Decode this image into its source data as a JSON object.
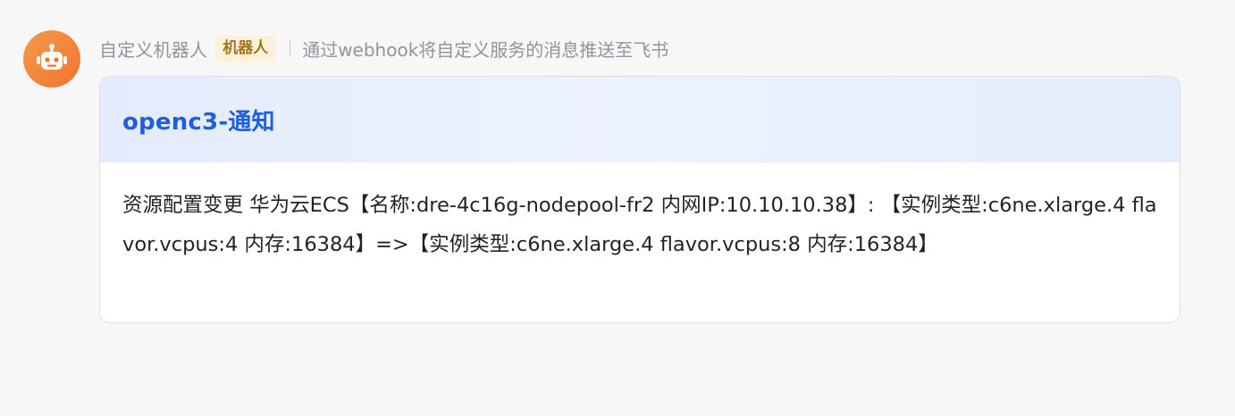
{
  "message": {
    "avatar_icon": "robot-icon",
    "avatar_color": "#f0732f",
    "sender_name": "自定义机器人",
    "badge": "机器人",
    "description": "通过webhook将自定义服务的消息推送至飞书"
  },
  "card": {
    "title": "openc3-通知",
    "title_color": "#1f5fde",
    "body": "资源配置变更 华为云ECS【名称:dre-4c16g-nodepool-fr2 内网IP:10.10.10.38】: 【实例类型:c6ne.xlarge.4 flavor.vcpus:4 内存:16384】=>【实例类型:c6ne.xlarge.4 flavor.vcpus:8 内存:16384】"
  }
}
